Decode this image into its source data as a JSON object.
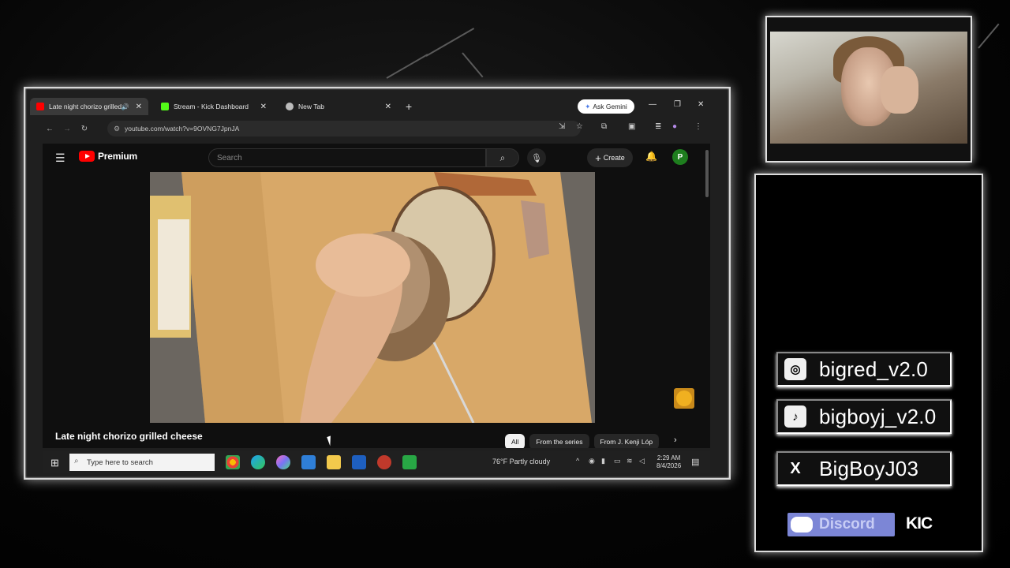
{
  "browser": {
    "tabs": [
      {
        "label": "Late night chorizo grilled ch",
        "favicon_color": "#ff0000",
        "active": true
      },
      {
        "label": "Stream - Kick Dashboard",
        "favicon_color": "#53fc18",
        "active": false
      },
      {
        "label": "New Tab",
        "favicon_color": "#bbbbbb",
        "active": false
      }
    ],
    "new_tab_icon": "plus-icon",
    "gemini_label": "Ask Gemini",
    "url": "youtube.com/watch?v=9OVNG7JpnJA"
  },
  "youtube": {
    "brand": "Premium",
    "search_placeholder": "Search",
    "create_label": "Create",
    "avatar_letter": "P",
    "video_title": "Late night chorizo grilled cheese",
    "chips": [
      "All",
      "From the series",
      "From J. Kenji Lóp"
    ],
    "accent": "#ff0000"
  },
  "taskbar": {
    "search_placeholder": "Type here to search",
    "weather": "76°F  Partly cloudy",
    "time": "2:29 AM",
    "date": "8/4/2026"
  },
  "overlay": {
    "socials": [
      {
        "icon": "instagram-icon",
        "glyph": "◎",
        "handle": "bigred_v2.0"
      },
      {
        "icon": "tiktok-icon",
        "glyph": "♪",
        "handle": "bigboyj_v2.0"
      },
      {
        "icon": "x-icon",
        "glyph": "X",
        "handle": "BigBoyJ03"
      }
    ],
    "discord_label": "Discord",
    "kick_label": "KIC",
    "discord_color": "#7c86d6"
  }
}
